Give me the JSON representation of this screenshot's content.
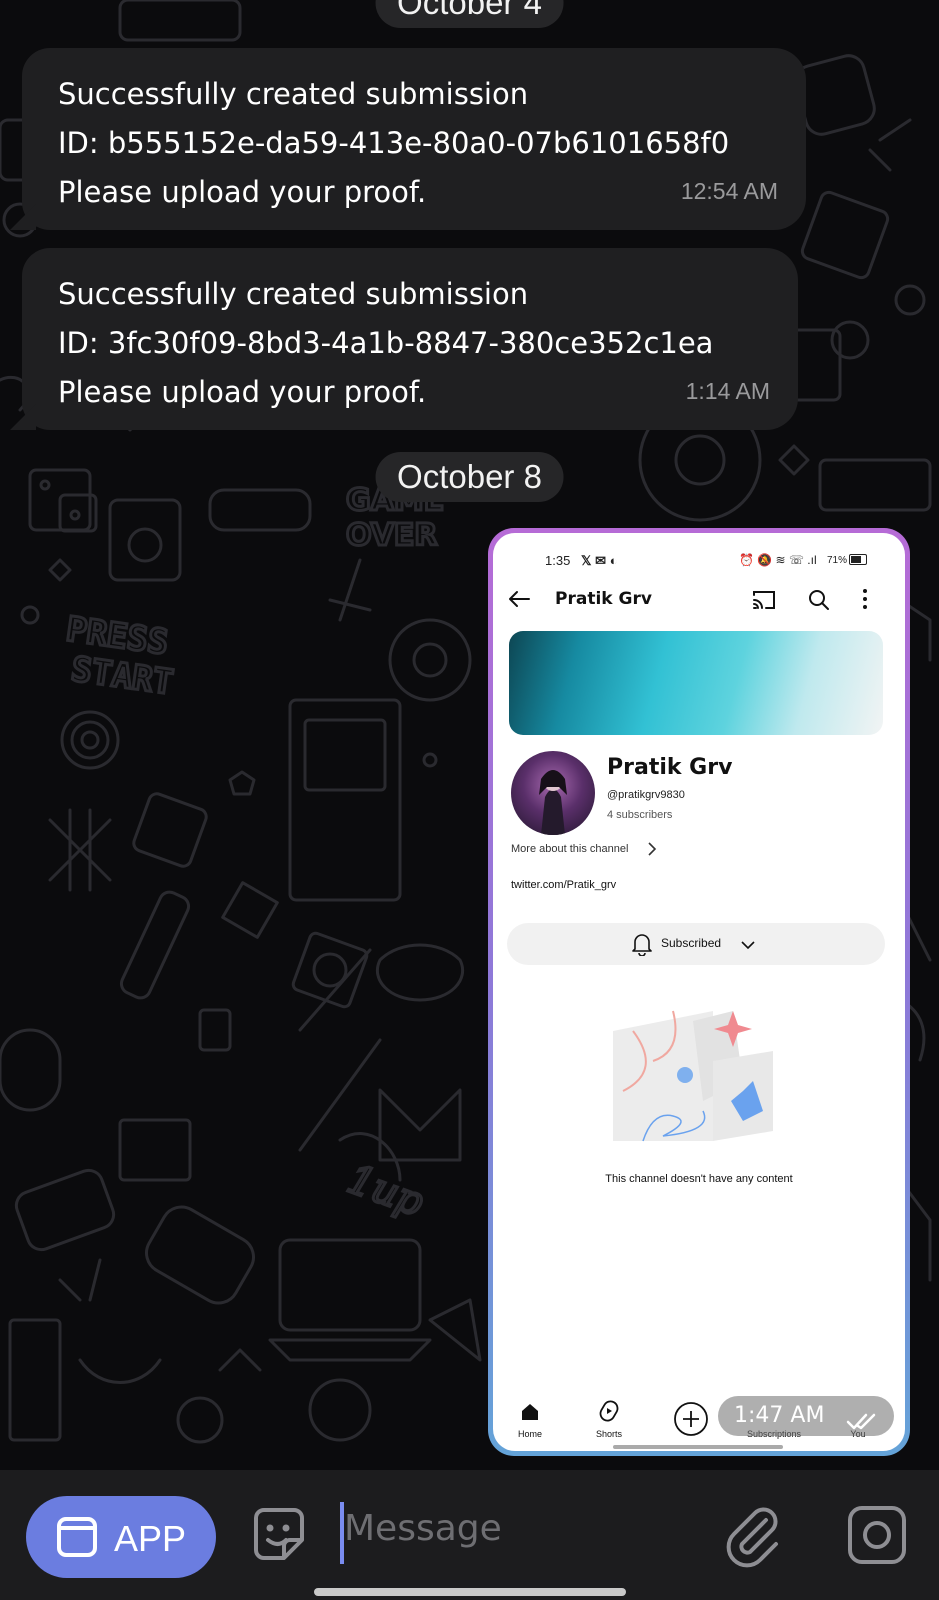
{
  "chat": {
    "date_top": "October 4",
    "date_mid": "October 8",
    "messages": [
      {
        "line1": "Successfully created submission",
        "line2": "ID: b555152e-da59-413e-80a0-07b6101658f0",
        "line3": "Please upload your proof.",
        "time": "12:54 AM"
      },
      {
        "line1": "Successfully created submission",
        "line2": "ID: 3fc30f09-8bd3-4a1b-8847-380ce352c1ea",
        "line3": "Please upload your proof.",
        "time": "1:14 AM"
      }
    ],
    "photo_time": "1:47 AM"
  },
  "screenshot": {
    "status_time": "1:35",
    "battery": "71%",
    "header_title": "Pratik Grv",
    "channel_name": "Pratik Grv",
    "handle": "@pratikgrv9830",
    "subscribers": "4 subscribers",
    "more_about": "More about this channel",
    "link": "twitter.com/Pratik_grv",
    "subscribed_label": "Subscribed",
    "empty_text": "This channel doesn't have any content",
    "nav": [
      "Home",
      "Shorts",
      "",
      "Subscriptions",
      "You"
    ]
  },
  "input": {
    "app_label": "APP",
    "placeholder": "Message"
  },
  "colors": {
    "background": "#0b0b0d",
    "bubble": "#1f1f21",
    "app_button": "#6b7de0"
  }
}
